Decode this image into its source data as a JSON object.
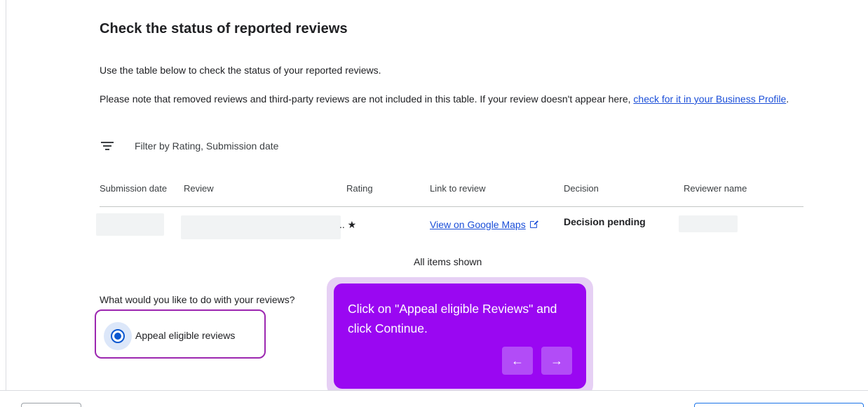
{
  "page": {
    "title": "Check the status of reported reviews",
    "intro": "Use the table below to check the status of your reported reviews.",
    "note_text": "Please note that removed reviews and third-party reviews are not included in this table. If your review doesn't appear here, ",
    "note_link": "check for it in your Business Profile",
    "note_end": "."
  },
  "filter": {
    "icon": "filter-icon",
    "label": "Filter by Rating, Submission date"
  },
  "table": {
    "columns": [
      "Submission date",
      "Review",
      "Rating",
      "Link to review",
      "Decision",
      "Reviewer name"
    ],
    "rows": [
      {
        "rating_suffix": ".. ★",
        "link": "View on Google Maps",
        "decision": "Decision pending"
      }
    ],
    "footer": "All items shown"
  },
  "action": {
    "question": "What would you like to do with your reviews?",
    "option_label": "Appeal eligible reviews",
    "selected": true
  },
  "tooltip": {
    "text": "Click on \"Appeal eligible Reviews\" and click Continue.",
    "prev_glyph": "←",
    "next_glyph": "→"
  },
  "colors": {
    "accent_blue": "#0b57d0",
    "link_blue": "#1a4ed8",
    "tooltip_purple": "#9a07f2",
    "highlight_border": "#9c27b0"
  }
}
